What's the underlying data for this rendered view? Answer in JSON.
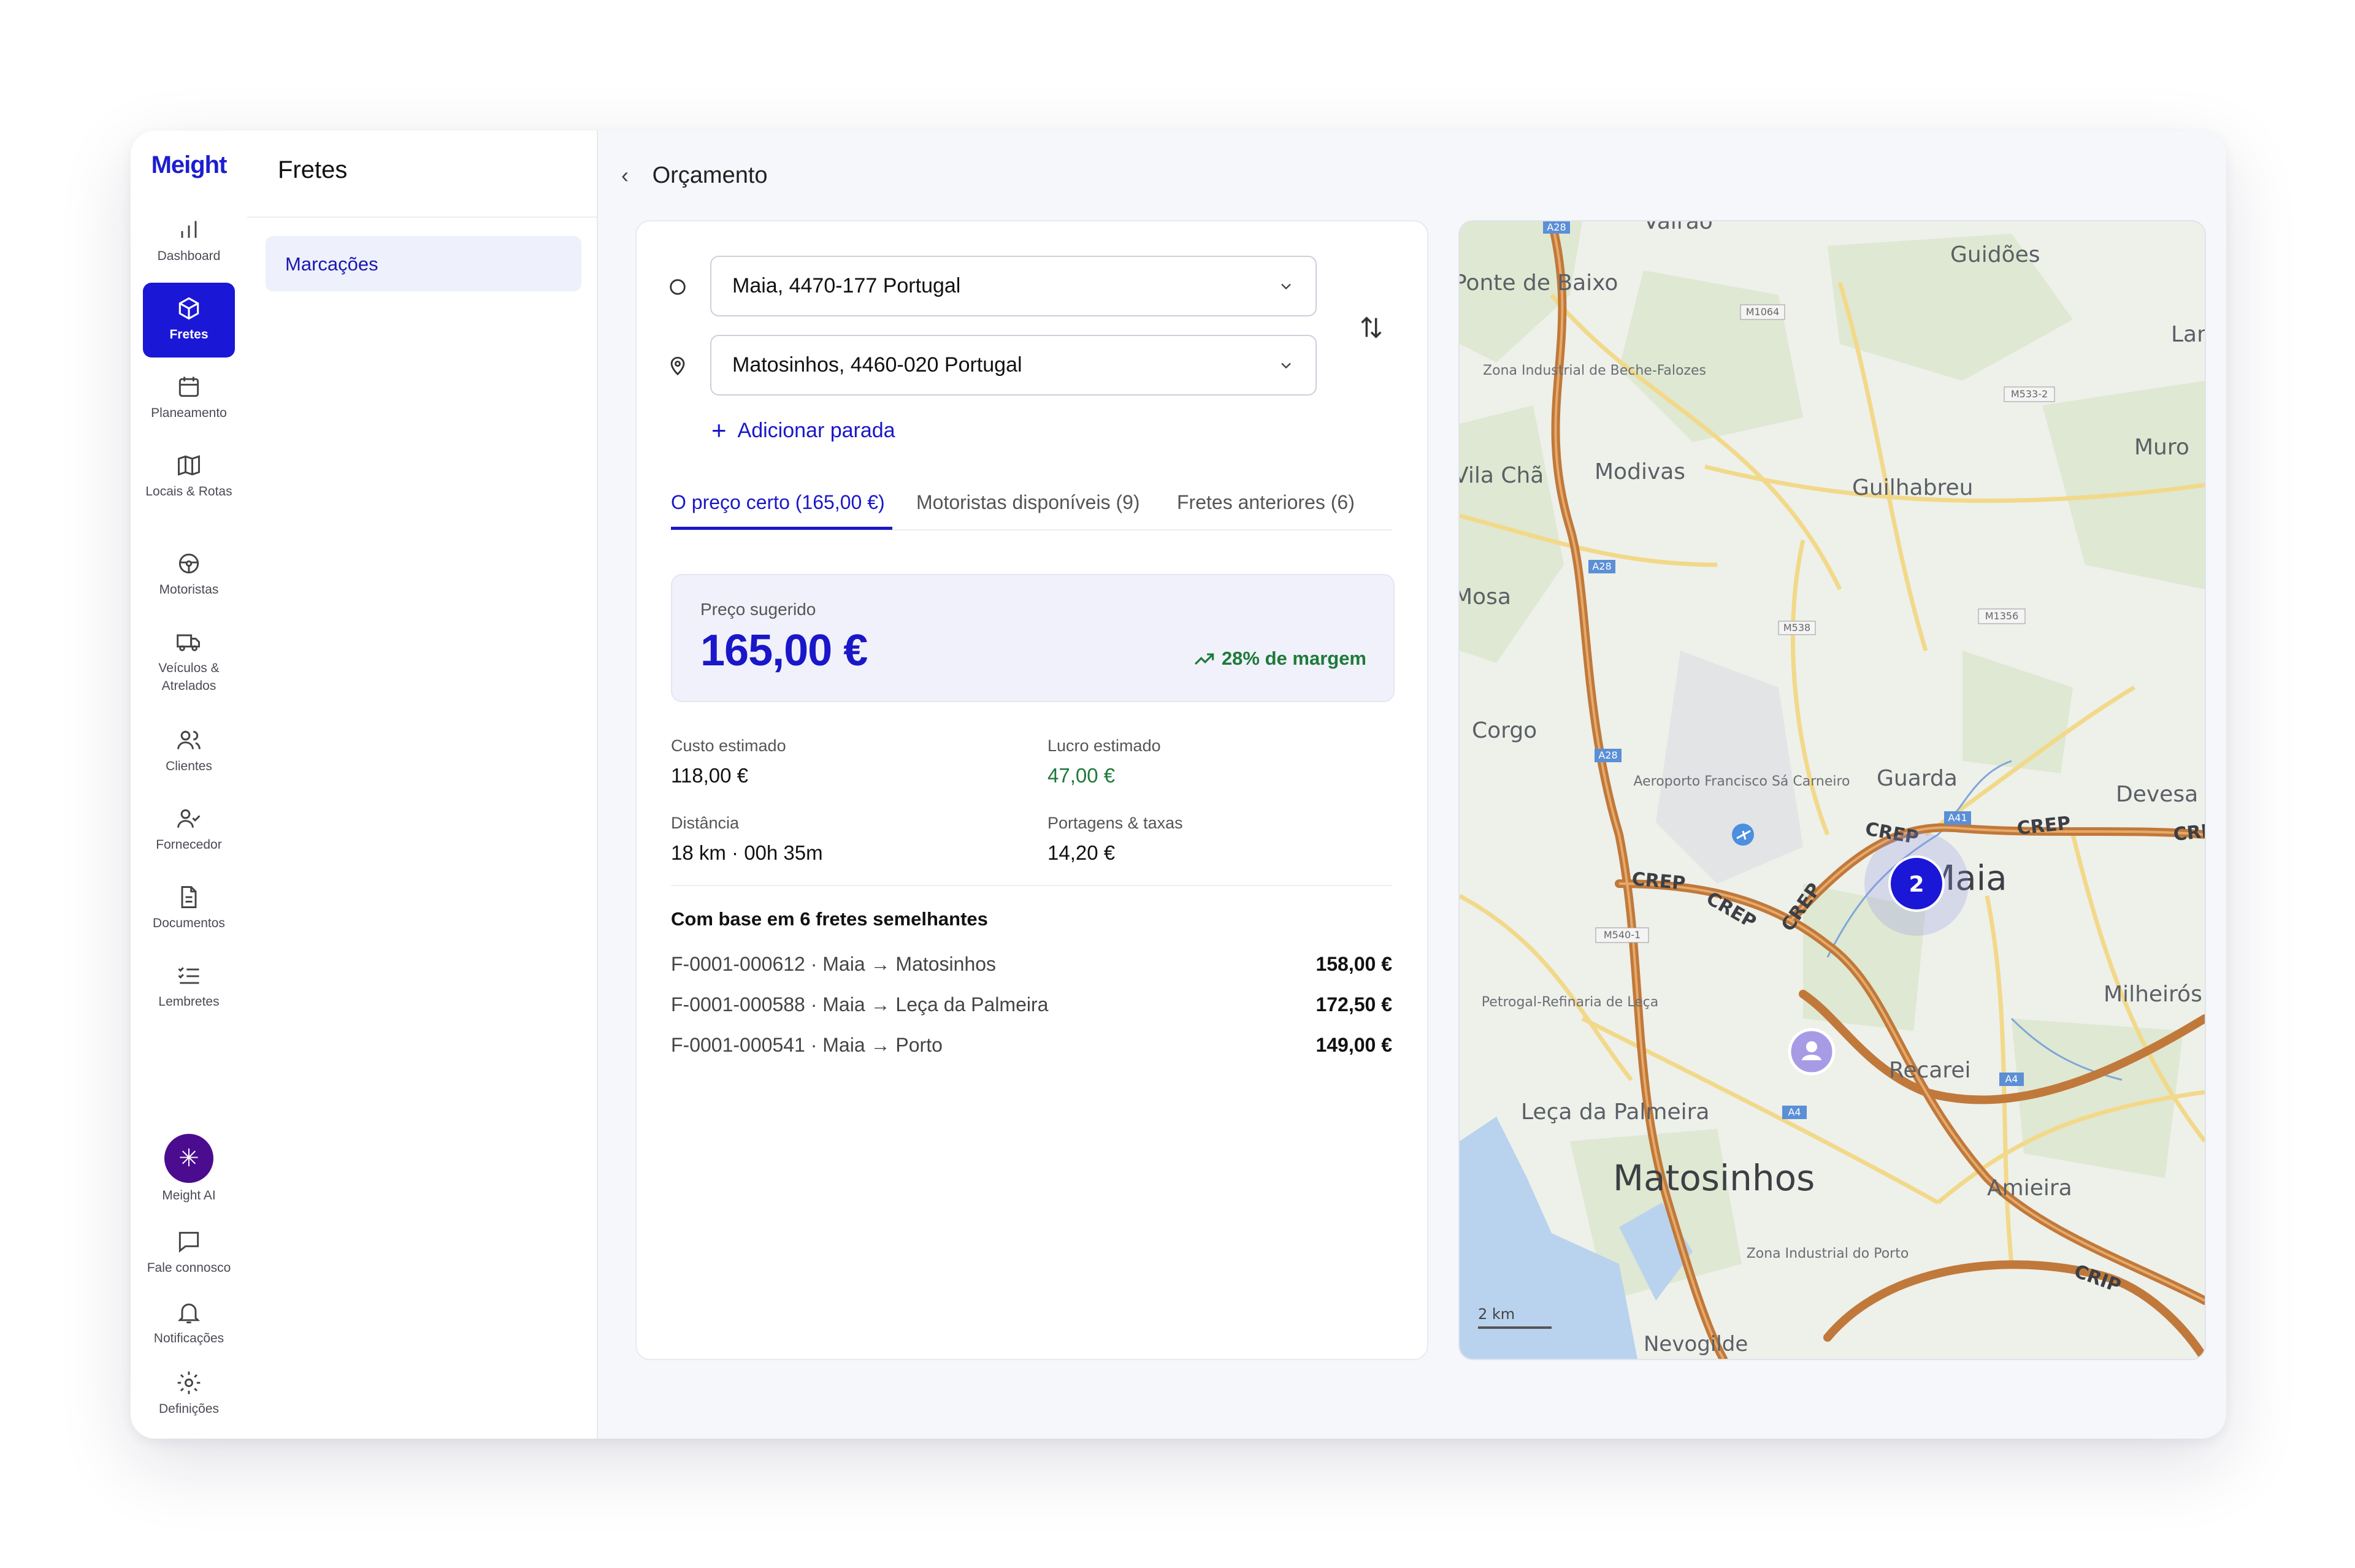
{
  "app": {
    "logo": "Meight"
  },
  "nav": {
    "items": [
      {
        "label": "Dashboard",
        "icon": "bar-chart-icon"
      },
      {
        "label": "Fretes",
        "icon": "box-icon",
        "active": true
      },
      {
        "label": "Planeamento",
        "icon": "calendar-icon"
      },
      {
        "label": "Locais & Rotas",
        "icon": "map-icon"
      },
      {
        "label": "Motoristas",
        "icon": "steering-wheel-icon"
      },
      {
        "label": "Veículos & Atrelados",
        "icon": "truck-icon"
      },
      {
        "label": "Clientes",
        "icon": "users-icon"
      },
      {
        "label": "Fornecedor",
        "icon": "user-check-icon"
      },
      {
        "label": "Documentos",
        "icon": "document-icon"
      },
      {
        "label": "Lembretes",
        "icon": "checklist-icon"
      }
    ],
    "bottom": [
      {
        "label": "Meight AI",
        "icon": "sparkle-icon"
      },
      {
        "label": "Fale connosco",
        "icon": "chat-icon"
      },
      {
        "label": "Notificações",
        "icon": "bell-icon"
      },
      {
        "label": "Definições",
        "icon": "gear-icon"
      }
    ]
  },
  "panel": {
    "title": "Fretes",
    "sub_item": "Marcações"
  },
  "header": {
    "title": "Orçamento"
  },
  "route": {
    "origin": "Maia, 4470-177 Portugal",
    "destination": "Matosinhos, 4460-020 Portugal",
    "add_stop": "Adicionar parada"
  },
  "tabs": [
    {
      "label": "O preço certo (165,00 €)",
      "active": true
    },
    {
      "label": "Motoristas disponíveis (9)"
    },
    {
      "label": "Fretes anteriores (6)"
    }
  ],
  "price": {
    "label": "Preço sugerido",
    "value": "165,00 €",
    "margin": "28% de margem"
  },
  "stats": {
    "cost_label": "Custo estimado",
    "cost": "118,00 €",
    "profit_label": "Lucro estimado",
    "profit": "47,00 €",
    "distance_label": "Distância",
    "distance": "18 km · 00h 35m",
    "tolls_label": "Portagens & taxas",
    "tolls": "14,20 €"
  },
  "similar": {
    "title": "Com base em 6 fretes semelhantes",
    "rows": [
      {
        "ref": "F-0001-000612 · Maia → Matosinhos",
        "amount": "158,00 €"
      },
      {
        "ref": "F-0001-000588 · Maia → Leça da Palmeira",
        "amount": "172,50 €"
      },
      {
        "ref": "F-0001-000541 · Maia → Porto",
        "amount": "149,00 €"
      }
    ]
  },
  "map": {
    "places": [
      "Vairão",
      "Guidões",
      "Ponte de Baixo",
      "Zona Industrial de Beche-Falozes",
      "Lan",
      "Muro",
      "Vila Chã",
      "Modivas",
      "Guilhabreu",
      "Mosa",
      "Corgo",
      "Aeroporto Francisco Sá Carneiro",
      "Guarda",
      "Devesa",
      "Maia",
      "Petrogal-Refinaria de Leça",
      "Milheirós",
      "Recarei",
      "Leça da Palmeira",
      "Matosinhos",
      "Amieira",
      "Zona Industrial do Porto",
      "Nevogilde"
    ],
    "roads": [
      "A28",
      "M1064",
      "M533-2",
      "A28",
      "M538",
      "M1356",
      "A28",
      "A41",
      "M540-1",
      "A4",
      "A4",
      "CREP",
      "CREP",
      "CREP",
      "CREP",
      "CREP",
      "CREP",
      "CRIP"
    ],
    "cluster_count": "2",
    "scale": "2 km",
    "zoom_in": "+",
    "zoom_out": "−",
    "colors": {
      "land": "#eef0ea",
      "water": "#b9d3ee",
      "highway": "#c0793a",
      "road": "#f2d98a",
      "green": "#dfe8d2"
    }
  }
}
